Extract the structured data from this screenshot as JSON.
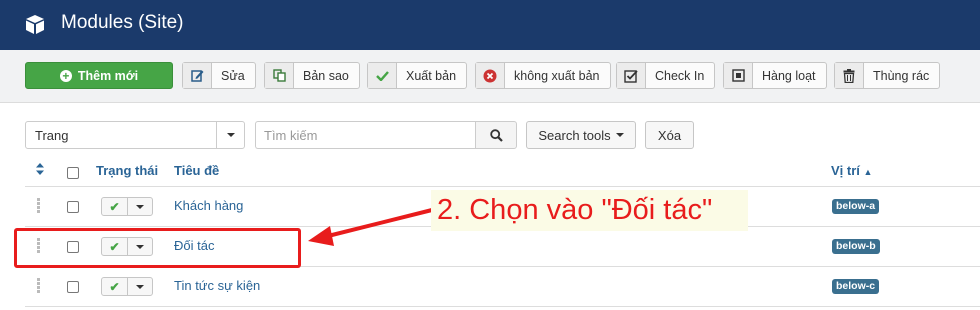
{
  "header": {
    "title": "Modules (Site)",
    "icon": "cube-icon"
  },
  "toolbar": {
    "new_label": "Thêm mới",
    "buttons": [
      {
        "label": "Sửa",
        "icon": "edit-icon"
      },
      {
        "label": "Bản sao",
        "icon": "copy-icon"
      },
      {
        "label": "Xuất bản",
        "icon": "check-icon"
      },
      {
        "label": "không xuất bản",
        "icon": "unpublish-icon"
      },
      {
        "label": "Check In",
        "icon": "checkbox-icon"
      },
      {
        "label": "Hàng loạt",
        "icon": "batch-icon"
      },
      {
        "label": "Thùng rác",
        "icon": "trash-icon"
      }
    ]
  },
  "filters": {
    "client_select": "Trang",
    "search_placeholder": "Tìm kiếm",
    "search_tools_label": "Search tools",
    "clear_label": "Xóa"
  },
  "table": {
    "headers": {
      "status": "Trạng thái",
      "title": "Tiêu đề",
      "position": "Vị trí"
    },
    "rows": [
      {
        "title": "Khách hàng",
        "position": "below-a"
      },
      {
        "title": "Đối tác",
        "position": "below-b"
      },
      {
        "title": "Tin tức sự kiện",
        "position": "below-c"
      }
    ]
  },
  "annotation": {
    "text": "2. Chọn vào \"Đối tác\"",
    "color": "#e81c1c"
  },
  "colors": {
    "header_bg": "#1b3a6b",
    "new_button": "#46a546",
    "link": "#2a6496",
    "badge": "#3a6f8f"
  }
}
